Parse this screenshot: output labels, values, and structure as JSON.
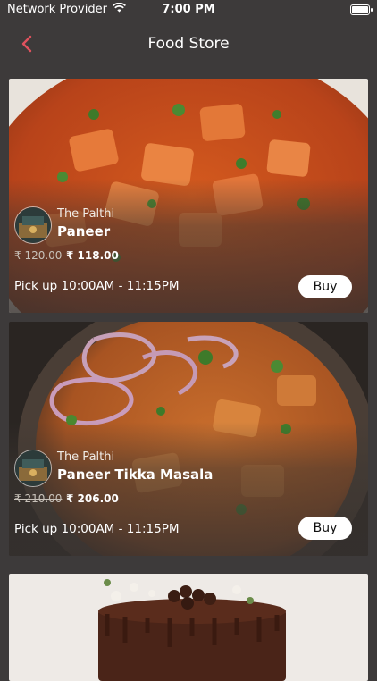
{
  "status": {
    "carrier": "Network Provider",
    "time": "7:00 PM",
    "battery_level": 1.0
  },
  "nav": {
    "title": "Food Store",
    "back_icon": "chevron-left-icon",
    "accent": "#e0525e"
  },
  "items": [
    {
      "store": "The Palthi",
      "name": "Paneer",
      "old_price": "₹ 120.00",
      "price": "₹ 118.00",
      "pickup": "Pick up 10:00AM - 11:15PM",
      "buy": "Buy"
    },
    {
      "store": "The Palthi",
      "name": "Paneer Tikka Masala",
      "old_price": "₹ 210.00",
      "price": "₹ 206.00",
      "pickup": "Pick up 10:00AM - 11:15PM",
      "buy": "Buy"
    }
  ]
}
